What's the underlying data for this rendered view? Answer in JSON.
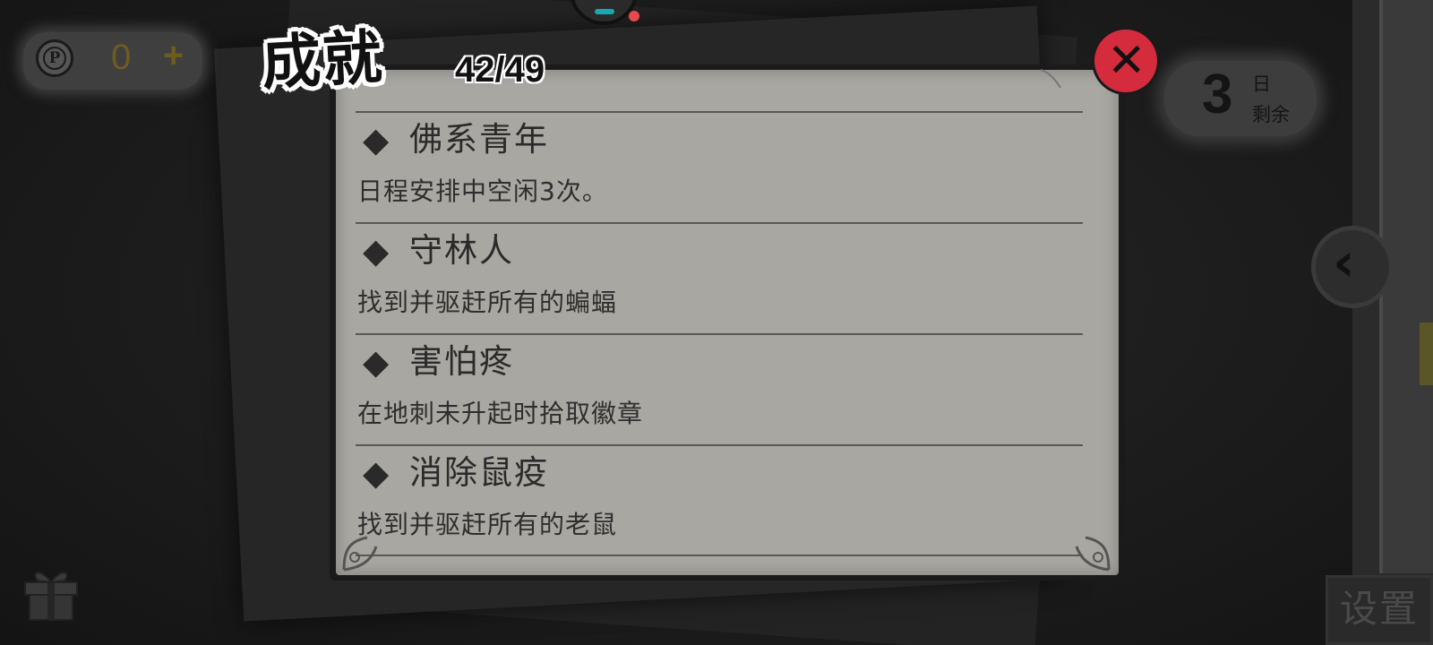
{
  "hud": {
    "coin_value": "0",
    "coin_plus": "+",
    "coin_symbol": "P",
    "days_number": "3",
    "days_unit": "日",
    "days_label": "剩余",
    "settings_label": "设置"
  },
  "dialog": {
    "title": "成就",
    "count": "42/49",
    "close_glyph": "✕",
    "items": [
      {
        "icon": "◆",
        "title": "佛系青年",
        "desc": "日程安排中空闲3次。"
      },
      {
        "icon": "◆",
        "title": "守林人",
        "desc": "找到并驱赶所有的蝙蝠"
      },
      {
        "icon": "◆",
        "title": "害怕疼",
        "desc": "在地刺未升起时拾取徽章"
      },
      {
        "icon": "◆",
        "title": "消除鼠疫",
        "desc": "找到并驱赶所有的老鼠"
      }
    ]
  },
  "icons": {
    "coin": "coin-p-icon",
    "gift": "gift-icon",
    "back": "chevron-left-icon",
    "close": "close-icon",
    "diamond": "diamond-bullet-icon"
  },
  "colors": {
    "close_button": "#d42c3c",
    "coin_text": "#6e5c1e",
    "parchment": "#a9a7a2",
    "gauge_accent": "#1fa7b0",
    "notification_dot": "#e74a4a"
  }
}
